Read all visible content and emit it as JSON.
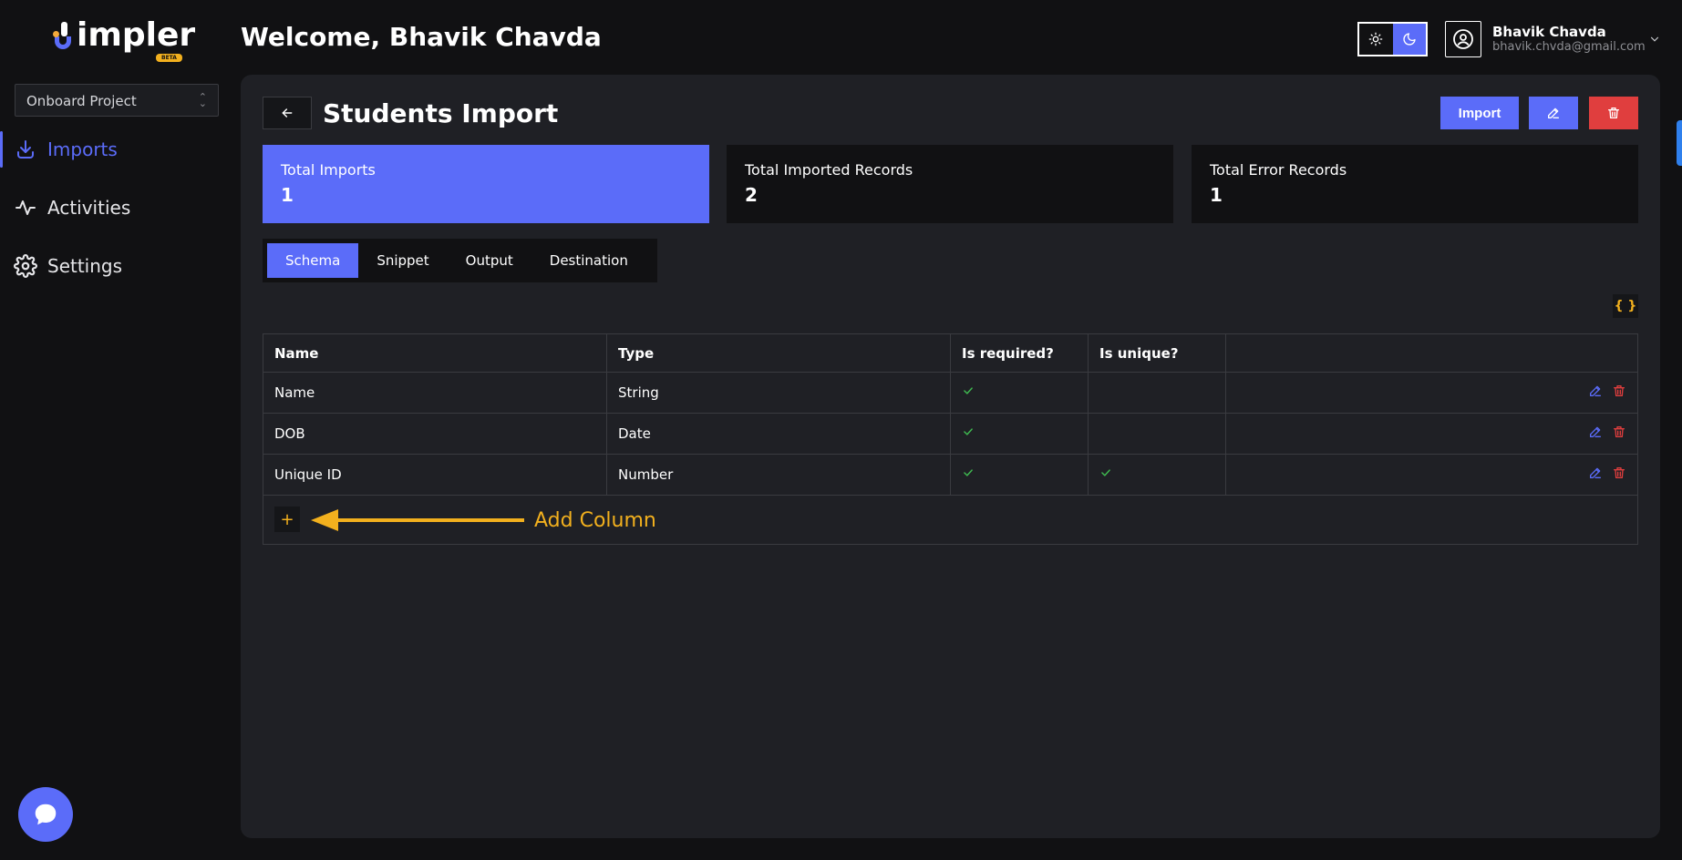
{
  "app": {
    "logo_text": "impler",
    "logo_badge": "BETA",
    "welcome": "Welcome, Bhavik Chavda"
  },
  "sidebar": {
    "project": "Onboard Project",
    "items": [
      {
        "label": "Imports",
        "icon": "download-icon",
        "active": true
      },
      {
        "label": "Activities",
        "icon": "activity-icon",
        "active": false
      },
      {
        "label": "Settings",
        "icon": "gear-icon",
        "active": false
      }
    ]
  },
  "user": {
    "name": "Bhavik Chavda",
    "email": "bhavik.chvda@gmail.com"
  },
  "page": {
    "title": "Students Import",
    "import_label": "Import"
  },
  "stats": [
    {
      "label": "Total Imports",
      "value": "1"
    },
    {
      "label": "Total Imported Records",
      "value": "2"
    },
    {
      "label": "Total Error Records",
      "value": "1"
    }
  ],
  "tabs": [
    "Schema",
    "Snippet",
    "Output",
    "Destination"
  ],
  "json_button": "{ }",
  "table": {
    "headers": [
      "Name",
      "Type",
      "Is required?",
      "Is unique?",
      ""
    ],
    "rows": [
      {
        "name": "Name",
        "type": "String",
        "required": true,
        "unique": false
      },
      {
        "name": "DOB",
        "type": "Date",
        "required": true,
        "unique": false
      },
      {
        "name": "Unique ID",
        "type": "Number",
        "required": true,
        "unique": true
      }
    ]
  },
  "add_button": "+",
  "annotation": "Add Column",
  "colors": {
    "accent": "#5b6cf9",
    "danger": "#e03e3e",
    "warning": "#f2b01e",
    "success": "#3fb950"
  }
}
